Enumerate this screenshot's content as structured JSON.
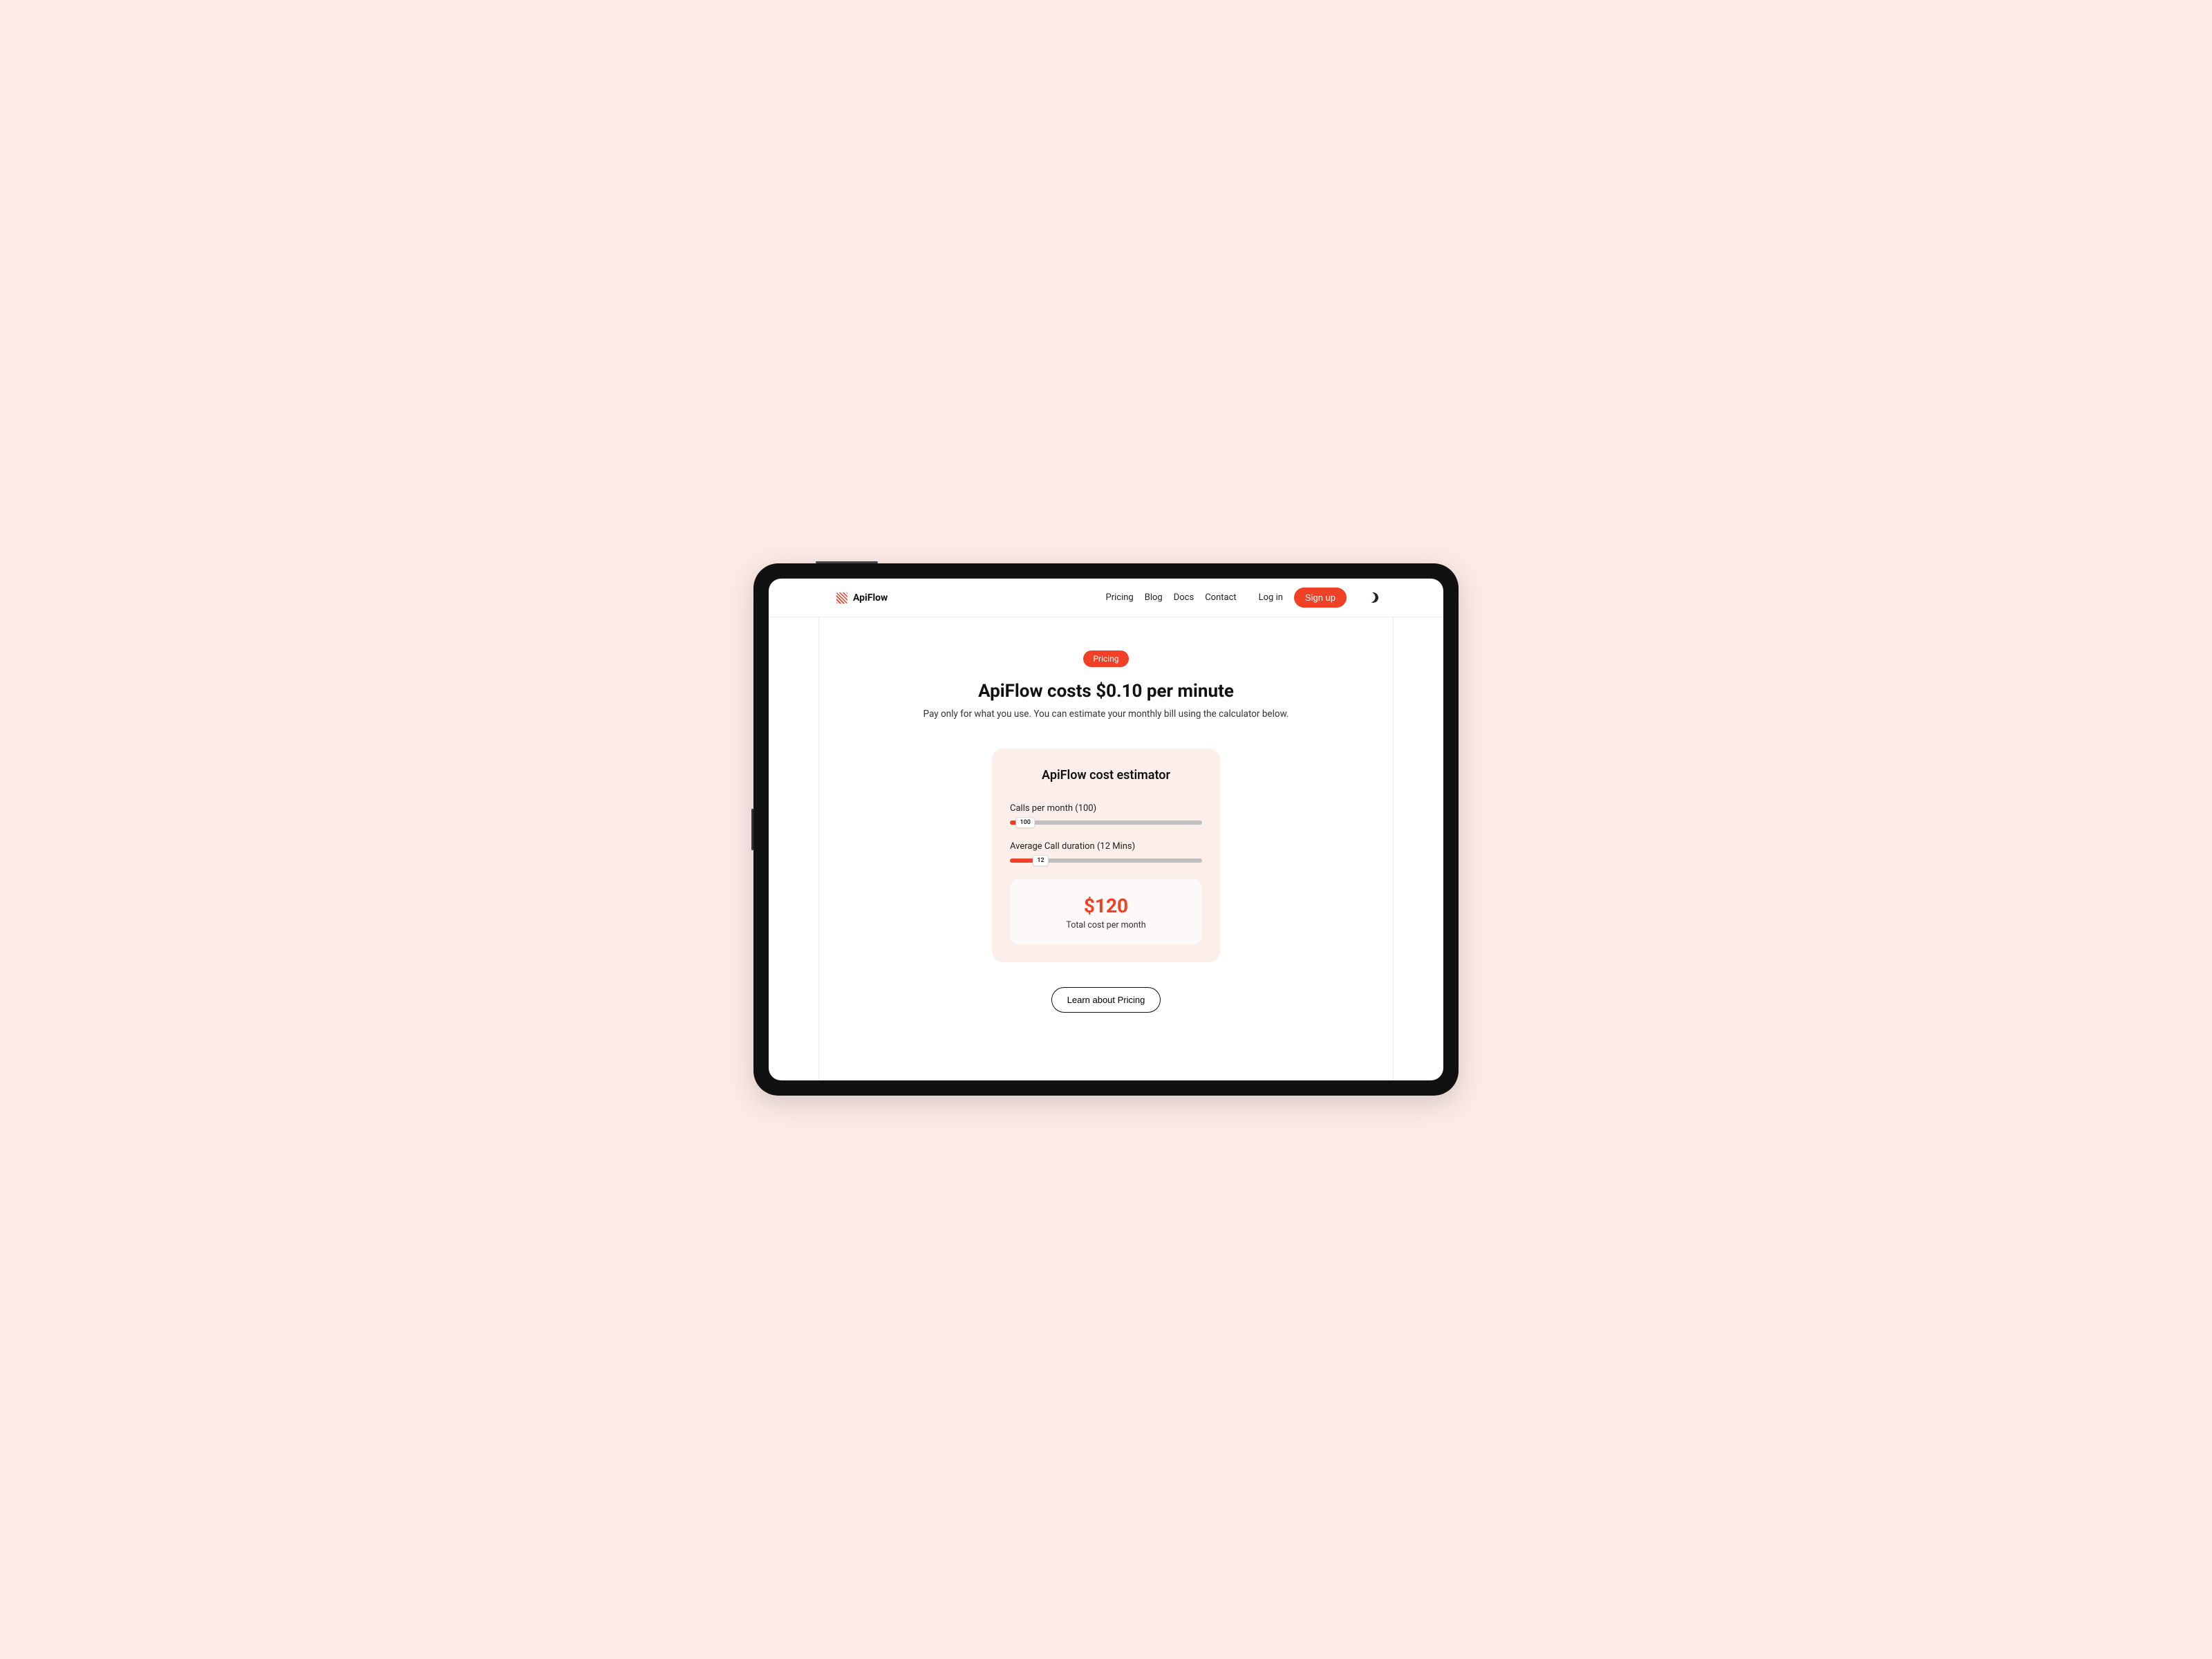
{
  "brand": {
    "name": "ApiFlow"
  },
  "nav": {
    "items": [
      "Pricing",
      "Blog",
      "Docs",
      "Contact"
    ],
    "login": "Log in",
    "signup": "Sign up"
  },
  "hero": {
    "badge": "Pricing",
    "headline": "ApiFlow costs $0.10 per minute",
    "subhead": "Pay only for what you use. You can estimate your monthly bill using the calculator below."
  },
  "estimator": {
    "title": "ApiFlow cost estimator",
    "slider1": {
      "label": "Calls per month (100)",
      "thumb": "100"
    },
    "slider2": {
      "label": "Average Call duration (12 Mins)",
      "thumb": "12"
    },
    "result": {
      "amount": "$120",
      "caption": "Total cost per month"
    }
  },
  "cta": {
    "learn": "Learn about Pricing"
  },
  "colors": {
    "accent": "#f04025",
    "card_bg": "#fceee9",
    "page_bg": "#fbeae6"
  }
}
